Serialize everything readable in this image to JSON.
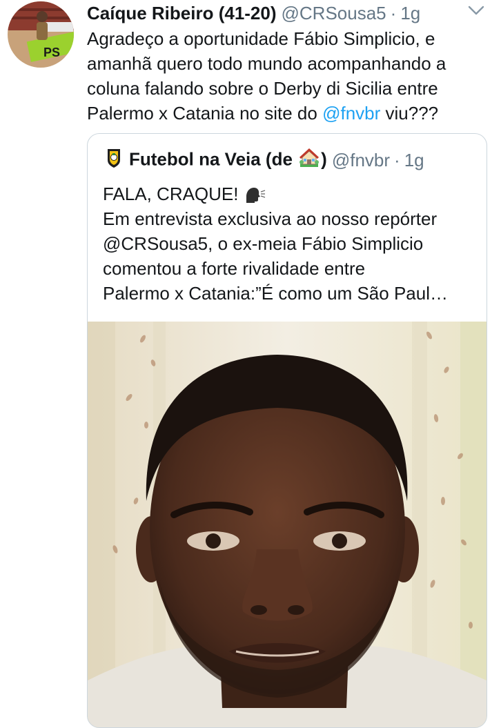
{
  "tweet": {
    "author_name": "Caíque Ribeiro (41-20)",
    "handle": "@CRSousa5",
    "separator": "·",
    "time": "1g",
    "text": {
      "lines": [
        "Agradeço a oportunidade Fábio Simplicio, e",
        "amanhã quero todo mundo acompanhando a",
        "coluna falando sobre o Derby di Sicilia entre"
      ],
      "last_line_prefix": "Palermo x Catania no site do ",
      "mention": "@fnvbr",
      "last_line_suffix": " viu???"
    }
  },
  "quoted_tweet": {
    "author_name_prefix": "Futebol na Veia (de",
    "author_name_suffix": ")",
    "handle": "@fnvbr",
    "separator": "·",
    "time": "1g",
    "headline": "FALA, CRAQUE!",
    "lines": [
      "Em entrevista exclusiva ao nosso repórter",
      "@CRSousa5, o ex-meia Fábio Simplicio",
      "comentou a forte rivalidade entre",
      "Palermo x Catania:”É como um São Paul…"
    ]
  },
  "icons": {
    "chevron": "chevron-down-icon",
    "quote_avatar": "football-shield-icon",
    "house": "house-emoji-icon",
    "speaking": "speaking-head-icon"
  },
  "colors": {
    "text": "#14171a",
    "secondary": "#657786",
    "link": "#1da1f2",
    "border": "#ccd6dd"
  }
}
